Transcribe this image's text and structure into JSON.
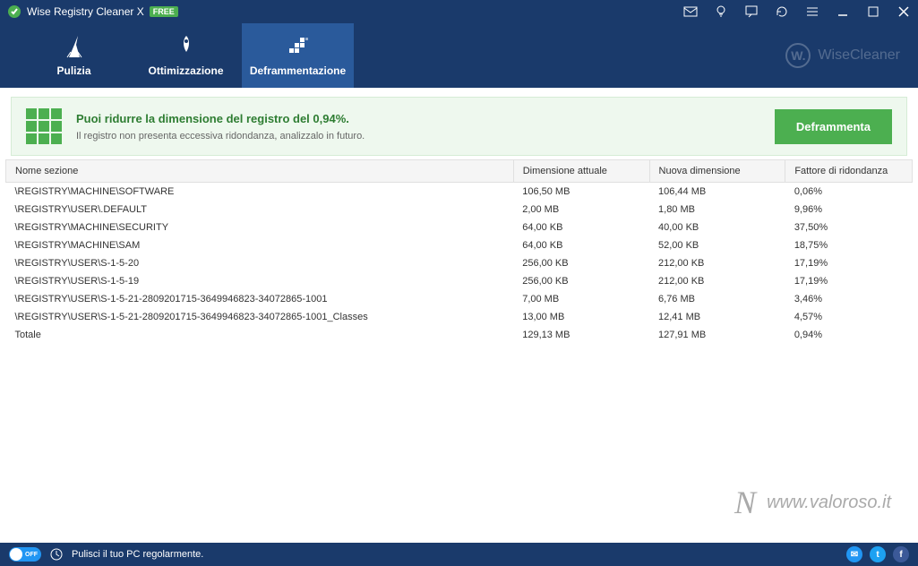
{
  "titlebar": {
    "app_name": "Wise Registry Cleaner X",
    "badge": "FREE"
  },
  "tabs": {
    "clean": "Pulizia",
    "optimize": "Ottimizzazione",
    "defrag": "Deframmentazione"
  },
  "brand": "WiseCleaner",
  "banner": {
    "title": "Puoi ridurre la dimensione del registro del 0,94%.",
    "subtitle": "Il registro non presenta eccessiva ridondanza, analizzalo in futuro.",
    "button": "Deframmenta"
  },
  "table": {
    "headers": {
      "name": "Nome sezione",
      "current": "Dimensione attuale",
      "new": "Nuova dimensione",
      "redundancy": "Fattore di ridondanza"
    },
    "rows": [
      {
        "name": "\\REGISTRY\\MACHINE\\SOFTWARE",
        "current": "106,50 MB",
        "new": "106,44 MB",
        "red": "0,06%"
      },
      {
        "name": "\\REGISTRY\\USER\\.DEFAULT",
        "current": "2,00 MB",
        "new": "1,80 MB",
        "red": "9,96%"
      },
      {
        "name": "\\REGISTRY\\MACHINE\\SECURITY",
        "current": "64,00 KB",
        "new": "40,00 KB",
        "red": "37,50%"
      },
      {
        "name": "\\REGISTRY\\MACHINE\\SAM",
        "current": "64,00 KB",
        "new": "52,00 KB",
        "red": "18,75%"
      },
      {
        "name": "\\REGISTRY\\USER\\S-1-5-20",
        "current": "256,00 KB",
        "new": "212,00 KB",
        "red": "17,19%"
      },
      {
        "name": "\\REGISTRY\\USER\\S-1-5-19",
        "current": "256,00 KB",
        "new": "212,00 KB",
        "red": "17,19%"
      },
      {
        "name": "\\REGISTRY\\USER\\S-1-5-21-2809201715-3649946823-34072865-1001",
        "current": "7,00 MB",
        "new": "6,76 MB",
        "red": "3,46%"
      },
      {
        "name": "\\REGISTRY\\USER\\S-1-5-21-2809201715-3649946823-34072865-1001_Classes",
        "current": "13,00 MB",
        "new": "12,41 MB",
        "red": "4,57%"
      },
      {
        "name": "Totale",
        "current": "129,13 MB",
        "new": "127,91 MB",
        "red": "0,94%"
      }
    ]
  },
  "watermark": "www.valoroso.it",
  "statusbar": {
    "toggle": "OFF",
    "text": "Pulisci il tuo PC regolarmente."
  }
}
